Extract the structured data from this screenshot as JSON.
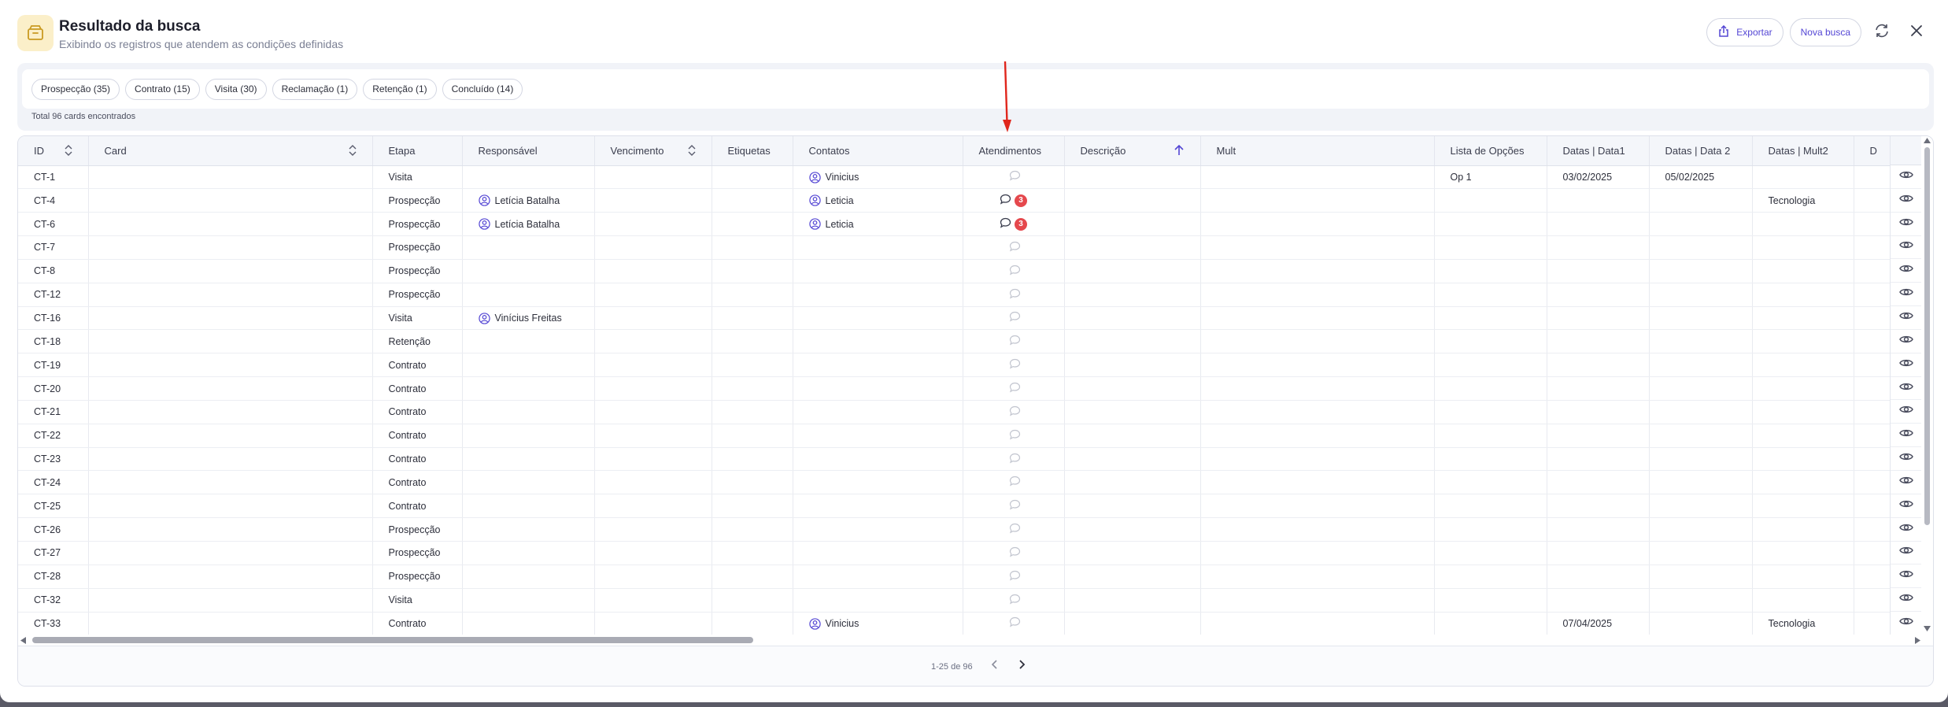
{
  "header": {
    "title": "Resultado da busca",
    "subtitle": "Exibindo os registros que atendem as condições definidas",
    "export_label": "Exportar",
    "new_search_label": "Nova busca"
  },
  "filters": {
    "chips": [
      {
        "label": "Prospecção (35)"
      },
      {
        "label": "Contrato (15)"
      },
      {
        "label": "Visita (30)"
      },
      {
        "label": "Reclamação (1)"
      },
      {
        "label": "Retenção (1)"
      },
      {
        "label": "Concluído (14)"
      }
    ],
    "total": "Total 96 cards encontrados"
  },
  "table": {
    "columns": [
      "ID",
      "Card",
      "Etapa",
      "Responsável",
      "Vencimento",
      "Etiquetas",
      "Contatos",
      "Atendimentos",
      "Descrição",
      "Mult",
      "Lista de Opções",
      "Datas | Data1",
      "Datas | Data 2",
      "Datas | Mult2",
      "D"
    ],
    "rows": [
      {
        "id": "CT-1",
        "etapa": "Visita",
        "responsavel": "",
        "contato": "Vinicius",
        "badge": "",
        "lista": "Op 1",
        "data1": "03/02/2025",
        "data2": "05/02/2025",
        "mult2": ""
      },
      {
        "id": "CT-4",
        "etapa": "Prospecção",
        "responsavel": "Letícia Batalha",
        "contato": "Leticia",
        "badge": "3",
        "lista": "",
        "data1": "",
        "data2": "",
        "mult2": "Tecnologia"
      },
      {
        "id": "CT-6",
        "etapa": "Prospecção",
        "responsavel": "Letícia Batalha",
        "contato": "Leticia",
        "badge": "3",
        "lista": "",
        "data1": "",
        "data2": "",
        "mult2": ""
      },
      {
        "id": "CT-7",
        "etapa": "Prospecção",
        "responsavel": "",
        "contato": "",
        "badge": "",
        "lista": "",
        "data1": "",
        "data2": "",
        "mult2": ""
      },
      {
        "id": "CT-8",
        "etapa": "Prospecção",
        "responsavel": "",
        "contato": "",
        "badge": "",
        "lista": "",
        "data1": "",
        "data2": "",
        "mult2": ""
      },
      {
        "id": "CT-12",
        "etapa": "Prospecção",
        "responsavel": "",
        "contato": "",
        "badge": "",
        "lista": "",
        "data1": "",
        "data2": "",
        "mult2": ""
      },
      {
        "id": "CT-16",
        "etapa": "Visita",
        "responsavel": "Vinícius Freitas",
        "contato": "",
        "badge": "",
        "lista": "",
        "data1": "",
        "data2": "",
        "mult2": ""
      },
      {
        "id": "CT-18",
        "etapa": "Retenção",
        "responsavel": "",
        "contato": "",
        "badge": "",
        "lista": "",
        "data1": "",
        "data2": "",
        "mult2": ""
      },
      {
        "id": "CT-19",
        "etapa": "Contrato",
        "responsavel": "",
        "contato": "",
        "badge": "",
        "lista": "",
        "data1": "",
        "data2": "",
        "mult2": ""
      },
      {
        "id": "CT-20",
        "etapa": "Contrato",
        "responsavel": "",
        "contato": "",
        "badge": "",
        "lista": "",
        "data1": "",
        "data2": "",
        "mult2": ""
      },
      {
        "id": "CT-21",
        "etapa": "Contrato",
        "responsavel": "",
        "contato": "",
        "badge": "",
        "lista": "",
        "data1": "",
        "data2": "",
        "mult2": ""
      },
      {
        "id": "CT-22",
        "etapa": "Contrato",
        "responsavel": "",
        "contato": "",
        "badge": "",
        "lista": "",
        "data1": "",
        "data2": "",
        "mult2": ""
      },
      {
        "id": "CT-23",
        "etapa": "Contrato",
        "responsavel": "",
        "contato": "",
        "badge": "",
        "lista": "",
        "data1": "",
        "data2": "",
        "mult2": ""
      },
      {
        "id": "CT-24",
        "etapa": "Contrato",
        "responsavel": "",
        "contato": "",
        "badge": "",
        "lista": "",
        "data1": "",
        "data2": "",
        "mult2": ""
      },
      {
        "id": "CT-25",
        "etapa": "Contrato",
        "responsavel": "",
        "contato": "",
        "badge": "",
        "lista": "",
        "data1": "",
        "data2": "",
        "mult2": ""
      },
      {
        "id": "CT-26",
        "etapa": "Prospecção",
        "responsavel": "",
        "contato": "",
        "badge": "",
        "lista": "",
        "data1": "",
        "data2": "",
        "mult2": ""
      },
      {
        "id": "CT-27",
        "etapa": "Prospecção",
        "responsavel": "",
        "contato": "",
        "badge": "",
        "lista": "",
        "data1": "",
        "data2": "",
        "mult2": ""
      },
      {
        "id": "CT-28",
        "etapa": "Prospecção",
        "responsavel": "",
        "contato": "",
        "badge": "",
        "lista": "",
        "data1": "",
        "data2": "",
        "mult2": ""
      },
      {
        "id": "CT-32",
        "etapa": "Visita",
        "responsavel": "",
        "contato": "",
        "badge": "",
        "lista": "",
        "data1": "",
        "data2": "",
        "mult2": ""
      },
      {
        "id": "CT-33",
        "etapa": "Contrato",
        "responsavel": "",
        "contato": "Vinicius",
        "badge": "",
        "lista": "",
        "data1": "07/04/2025",
        "data2": "",
        "mult2": "Tecnologia"
      }
    ]
  },
  "pagination": {
    "info": "1-25 de 96"
  },
  "colors": {
    "accent": "#5446d4",
    "badge": "#e5484d",
    "header_icon_bg": "#fbefc9",
    "annotation": "#e0261c"
  },
  "icons": {
    "header": "archive-box-icon",
    "export": "share-upload-icon",
    "refresh": "refresh-icon",
    "close": "close-icon",
    "sort": "sort-icon",
    "sort_active": "arrow-up-icon",
    "person": "user-circle-icon",
    "comment": "comment-icon",
    "view": "eye-icon"
  }
}
